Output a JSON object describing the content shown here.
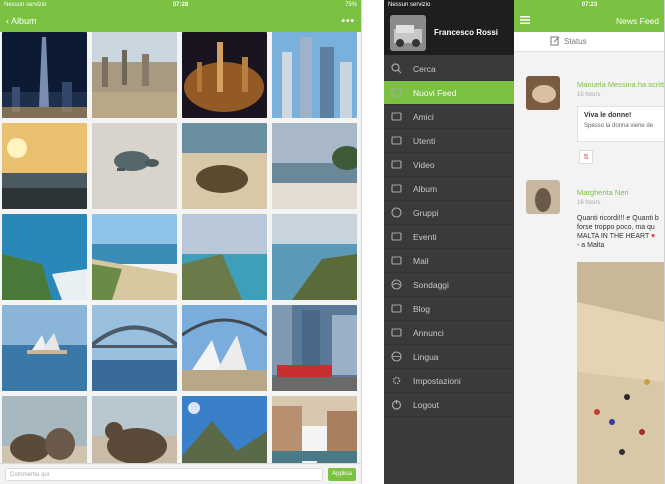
{
  "left": {
    "status": {
      "carrier": "Nessun servizio",
      "time": "07:28",
      "battery": "75%"
    },
    "nav": {
      "back_label": "Album",
      "more": "•••"
    },
    "comment_placeholder": "Commenta qui",
    "apply_label": "Applica"
  },
  "right": {
    "status": {
      "carrier": "Nessun servizio",
      "time": "07:23"
    },
    "profile_name": "Francesco Rossi",
    "menu": [
      "Cerca",
      "Nuovi Feed",
      "Amici",
      "Utenti",
      "Video",
      "Album",
      "Gruppi",
      "Eventi",
      "Mail",
      "Sondaggi",
      "Blog",
      "Annunci",
      "Lingua",
      "Impostazioni",
      "Logout"
    ],
    "active_index": 1,
    "feed_title": "News Feed",
    "status_label": "Status",
    "posts": [
      {
        "name": "Manuela Messina ha scritt",
        "time": "15 hours",
        "title": "Viva le donne!",
        "text": "Spesso la donna viene de"
      },
      {
        "name": "Margherita Neri",
        "time": "16 hours",
        "text": [
          "Quanti ricordi!!! e Quanti b",
          "forse troppo poco, ma qu",
          "MALTA IN THE HEART",
          "- a Malta"
        ]
      }
    ]
  },
  "accent": "#7cc242"
}
